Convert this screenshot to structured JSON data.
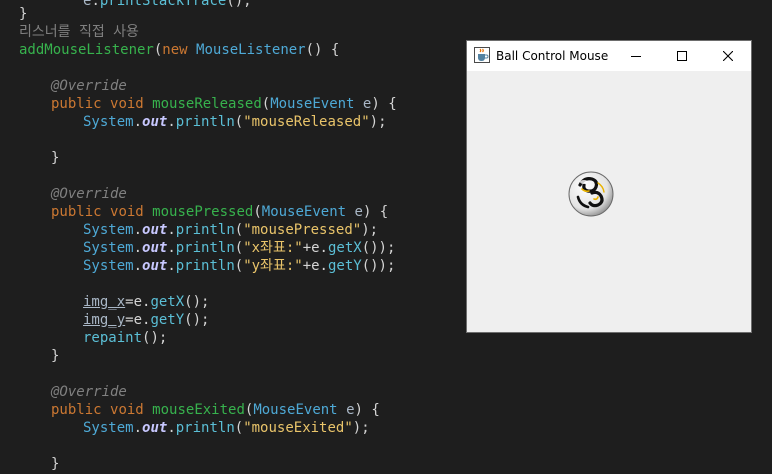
{
  "editor": {
    "l1": {
      "sys": "e",
      "dot": ".",
      "call": "printStackTrace",
      "tail": "();"
    },
    "l2": {
      "brace": "}"
    },
    "l3": {
      "comment": "리스너를 직접 사용"
    },
    "l4": {
      "method": "addMouseListener",
      "open": "(",
      "kw": "new",
      "cls": "MouseListener",
      "tail": "() {"
    },
    "l6": {
      "ann": "@Override"
    },
    "l7": {
      "kw1": "public",
      "kw2": "void",
      "method": "mouseReleased",
      "open": "(",
      "cls": "MouseEvent",
      "param": "e",
      "close": ") {"
    },
    "l8": {
      "sys": "System",
      "dot1": ".",
      "out": "out",
      "dot2": ".",
      "call": "println",
      "open": "(",
      "str": "\"mouseReleased\"",
      "close": ");"
    },
    "l10": {
      "brace": "}"
    },
    "l12": {
      "ann": "@Override"
    },
    "l13": {
      "kw1": "public",
      "kw2": "void",
      "method": "mousePressed",
      "open": "(",
      "cls": "MouseEvent",
      "param": "e",
      "close": ") {"
    },
    "l14": {
      "sys": "System",
      "dot1": ".",
      "out": "out",
      "dot2": ".",
      "call": "println",
      "open": "(",
      "str": "\"mousePressed\"",
      "close": ");"
    },
    "l15": {
      "sys": "System",
      "dot1": ".",
      "out": "out",
      "dot2": ".",
      "call": "println",
      "open": "(",
      "str": "\"x좌표:\"",
      "plus": "+e.",
      "call2": "getX",
      "close": "());"
    },
    "l16": {
      "sys": "System",
      "dot1": ".",
      "out": "out",
      "dot2": ".",
      "call": "println",
      "open": "(",
      "str": "\"y좌표:\"",
      "plus": "+e.",
      "call2": "getY",
      "close": "());"
    },
    "l18": {
      "var": "img_x",
      "eq": "=e.",
      "call": "getX",
      "close": "();"
    },
    "l19": {
      "var": "img_y",
      "eq": "=e.",
      "call": "getY",
      "close": "();"
    },
    "l20": {
      "call": "repaint",
      "close": "();"
    },
    "l21": {
      "brace": "}"
    },
    "l23": {
      "ann": "@Override"
    },
    "l24": {
      "kw1": "public",
      "kw2": "void",
      "method": "mouseExited",
      "open": "(",
      "cls": "MouseEvent",
      "param": "e",
      "close": ") {"
    },
    "l25": {
      "sys": "System",
      "dot1": ".",
      "out": "out",
      "dot2": ".",
      "call": "println",
      "open": "(",
      "str": "\"mouseExited\"",
      "close": ");"
    },
    "l27": {
      "brace": "}"
    }
  },
  "window": {
    "title": "Ball Control Mouse",
    "icons": {
      "app": "java-cup-icon",
      "minimize": "minimize-icon",
      "maximize": "maximize-icon",
      "close": "close-icon",
      "ball": "soccer-ball-icon"
    },
    "colors": {
      "titlebar": "#ffffff",
      "client": "#efefef",
      "editor_bg": "#1e1e1e"
    }
  }
}
